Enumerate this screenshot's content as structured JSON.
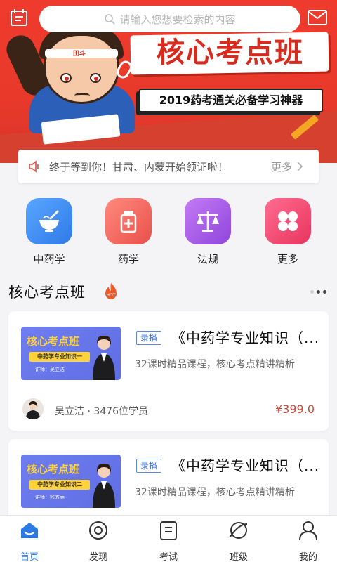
{
  "header": {
    "search_placeholder": "请输入您想要检索的内容",
    "icons": [
      "calendar-icon",
      "mail-icon"
    ]
  },
  "banner": {
    "title": "核心考点班",
    "subtitle": "2019药考通关必备学习神器",
    "headband_text": "田斗"
  },
  "notice": {
    "text": "终于等到你！甘肃、内蒙开始领证啦！",
    "more_label": "更多"
  },
  "categories": [
    {
      "label": "中药学",
      "icon": "mortar-icon",
      "color": "#3f8cf2"
    },
    {
      "label": "药学",
      "icon": "medicine-bottle-icon",
      "color": "#ef6461"
    },
    {
      "label": "法规",
      "icon": "scale-icon",
      "color": "#a45ae4"
    },
    {
      "label": "更多",
      "icon": "grid-icon",
      "color": "#f1476f"
    }
  ],
  "section": {
    "title": "核心考点班",
    "badge": "HOT"
  },
  "courses": [
    {
      "thumb_title": "核心考点班",
      "thumb_subtitle": "中药学专业知识一",
      "thumb_teacher": "讲师：吴立洁",
      "tag": "录播",
      "title": "《中药学专业知识（...",
      "desc": "32课时精品课程，核心考点精讲精析",
      "teacher": "吴立洁 · 3476位学员",
      "price": "¥399.0"
    },
    {
      "thumb_title": "核心考点班",
      "thumb_subtitle": "中药学专业知识二",
      "thumb_teacher": "讲师：钱秀丽",
      "tag": "录播",
      "title": "《中药学专业知识（...",
      "desc": "32课时精品课程，核心考点精讲精析",
      "teacher": "",
      "price": ""
    }
  ],
  "tabs": [
    {
      "label": "首页",
      "icon": "home-icon",
      "active": true
    },
    {
      "label": "发现",
      "icon": "discover-icon",
      "active": false
    },
    {
      "label": "考试",
      "icon": "exam-icon",
      "active": false
    },
    {
      "label": "班级",
      "icon": "class-icon",
      "active": false
    },
    {
      "label": "我的",
      "icon": "profile-icon",
      "active": false
    }
  ],
  "colors": {
    "banner_red": "#e8392b",
    "accent_blue": "#2c7be5",
    "price_red": "#d0463a"
  }
}
